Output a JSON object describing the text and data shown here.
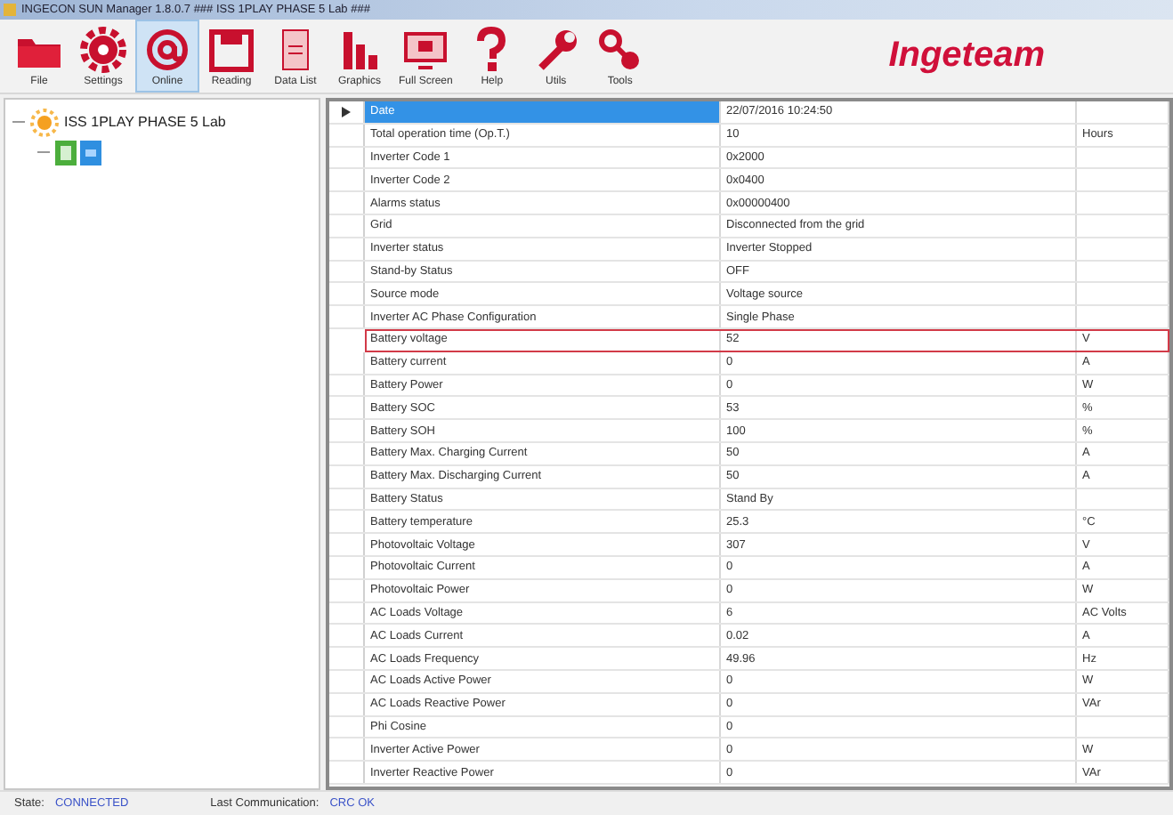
{
  "window": {
    "title": "INGECON SUN Manager 1.8.0.7 ### ISS 1PLAY PHASE 5 Lab ###"
  },
  "toolbar": [
    {
      "label": "File",
      "kind": "folder",
      "selected": false
    },
    {
      "label": "Settings",
      "kind": "gear",
      "selected": false
    },
    {
      "label": "Online",
      "kind": "at",
      "selected": true
    },
    {
      "label": "Reading",
      "kind": "reading",
      "selected": false
    },
    {
      "label": "Data List",
      "kind": "list",
      "selected": false
    },
    {
      "label": "Graphics",
      "kind": "bars",
      "selected": false
    },
    {
      "label": "Full Screen",
      "kind": "screen",
      "selected": false
    },
    {
      "label": "Help",
      "kind": "help",
      "selected": false
    },
    {
      "label": "Utils",
      "kind": "wrench",
      "selected": false
    },
    {
      "label": "Tools",
      "kind": "tools",
      "selected": false
    }
  ],
  "logo": "Ingeteam",
  "tree": [
    {
      "label": "ISS 1PLAY PHASE 5 Lab",
      "expanded": true,
      "children": [
        {
          "kind": "device",
          "expanded": true
        }
      ]
    }
  ],
  "table": {
    "rows": [
      {
        "name": "Date",
        "value": "22/07/2016 10:24:50",
        "unit": "",
        "selected": true,
        "highlighted": false
      },
      {
        "name": "Total operation time (Op.T.)",
        "value": "10",
        "unit": "Hours",
        "selected": false,
        "highlighted": false
      },
      {
        "name": "Inverter Code 1",
        "value": "0x2000",
        "unit": "",
        "selected": false,
        "highlighted": false
      },
      {
        "name": "Inverter Code 2",
        "value": "0x0400",
        "unit": "",
        "selected": false,
        "highlighted": false
      },
      {
        "name": "Alarms status",
        "value": "0x00000400",
        "unit": "",
        "selected": false,
        "highlighted": false
      },
      {
        "name": "Grid",
        "value": "Disconnected from the grid",
        "unit": "",
        "selected": false,
        "highlighted": false
      },
      {
        "name": "Inverter status",
        "value": "Inverter Stopped",
        "unit": "",
        "selected": false,
        "highlighted": false
      },
      {
        "name": "Stand-by Status",
        "value": "OFF",
        "unit": "",
        "selected": false,
        "highlighted": false
      },
      {
        "name": "Source mode",
        "value": "Voltage source",
        "unit": "",
        "selected": false,
        "highlighted": false
      },
      {
        "name": "Inverter AC Phase Configuration",
        "value": "Single Phase",
        "unit": "",
        "selected": false,
        "highlighted": false
      },
      {
        "name": "Battery voltage",
        "value": "52",
        "unit": "V",
        "selected": false,
        "highlighted": true
      },
      {
        "name": "Battery current",
        "value": "0",
        "unit": "A",
        "selected": false,
        "highlighted": false
      },
      {
        "name": "Battery Power",
        "value": "0",
        "unit": "W",
        "selected": false,
        "highlighted": false
      },
      {
        "name": "Battery SOC",
        "value": "53",
        "unit": "%",
        "selected": false,
        "highlighted": false
      },
      {
        "name": "Battery SOH",
        "value": "100",
        "unit": "%",
        "selected": false,
        "highlighted": false
      },
      {
        "name": "Battery Max. Charging Current",
        "value": "50",
        "unit": "A",
        "selected": false,
        "highlighted": false
      },
      {
        "name": "Battery Max. Discharging Current",
        "value": "50",
        "unit": "A",
        "selected": false,
        "highlighted": false
      },
      {
        "name": "Battery Status",
        "value": "Stand By",
        "unit": "",
        "selected": false,
        "highlighted": false
      },
      {
        "name": "Battery temperature",
        "value": "25.3",
        "unit": "°C",
        "selected": false,
        "highlighted": false
      },
      {
        "name": "Photovoltaic Voltage",
        "value": "307",
        "unit": "V",
        "selected": false,
        "highlighted": false
      },
      {
        "name": "Photovoltaic Current",
        "value": "0",
        "unit": "A",
        "selected": false,
        "highlighted": false
      },
      {
        "name": "Photovoltaic Power",
        "value": "0",
        "unit": "W",
        "selected": false,
        "highlighted": false
      },
      {
        "name": "AC Loads Voltage",
        "value": "6",
        "unit": "AC Volts",
        "selected": false,
        "highlighted": false
      },
      {
        "name": "AC Loads Current",
        "value": "0.02",
        "unit": "A",
        "selected": false,
        "highlighted": false
      },
      {
        "name": "AC Loads Frequency",
        "value": "49.96",
        "unit": "Hz",
        "selected": false,
        "highlighted": false
      },
      {
        "name": "AC Loads Active Power",
        "value": "0",
        "unit": "W",
        "selected": false,
        "highlighted": false
      },
      {
        "name": "AC Loads Reactive Power",
        "value": "0",
        "unit": "VAr",
        "selected": false,
        "highlighted": false
      },
      {
        "name": "Phi Cosine",
        "value": "0",
        "unit": "",
        "selected": false,
        "highlighted": false
      },
      {
        "name": "Inverter Active Power",
        "value": "0",
        "unit": "W",
        "selected": false,
        "highlighted": false
      },
      {
        "name": "Inverter Reactive Power",
        "value": "0",
        "unit": "VAr",
        "selected": false,
        "highlighted": false
      }
    ]
  },
  "status_bar": {
    "state_label": "State:",
    "state": "CONNECTED",
    "comm_label": "Last Communication:",
    "comm": "CRC OK"
  }
}
